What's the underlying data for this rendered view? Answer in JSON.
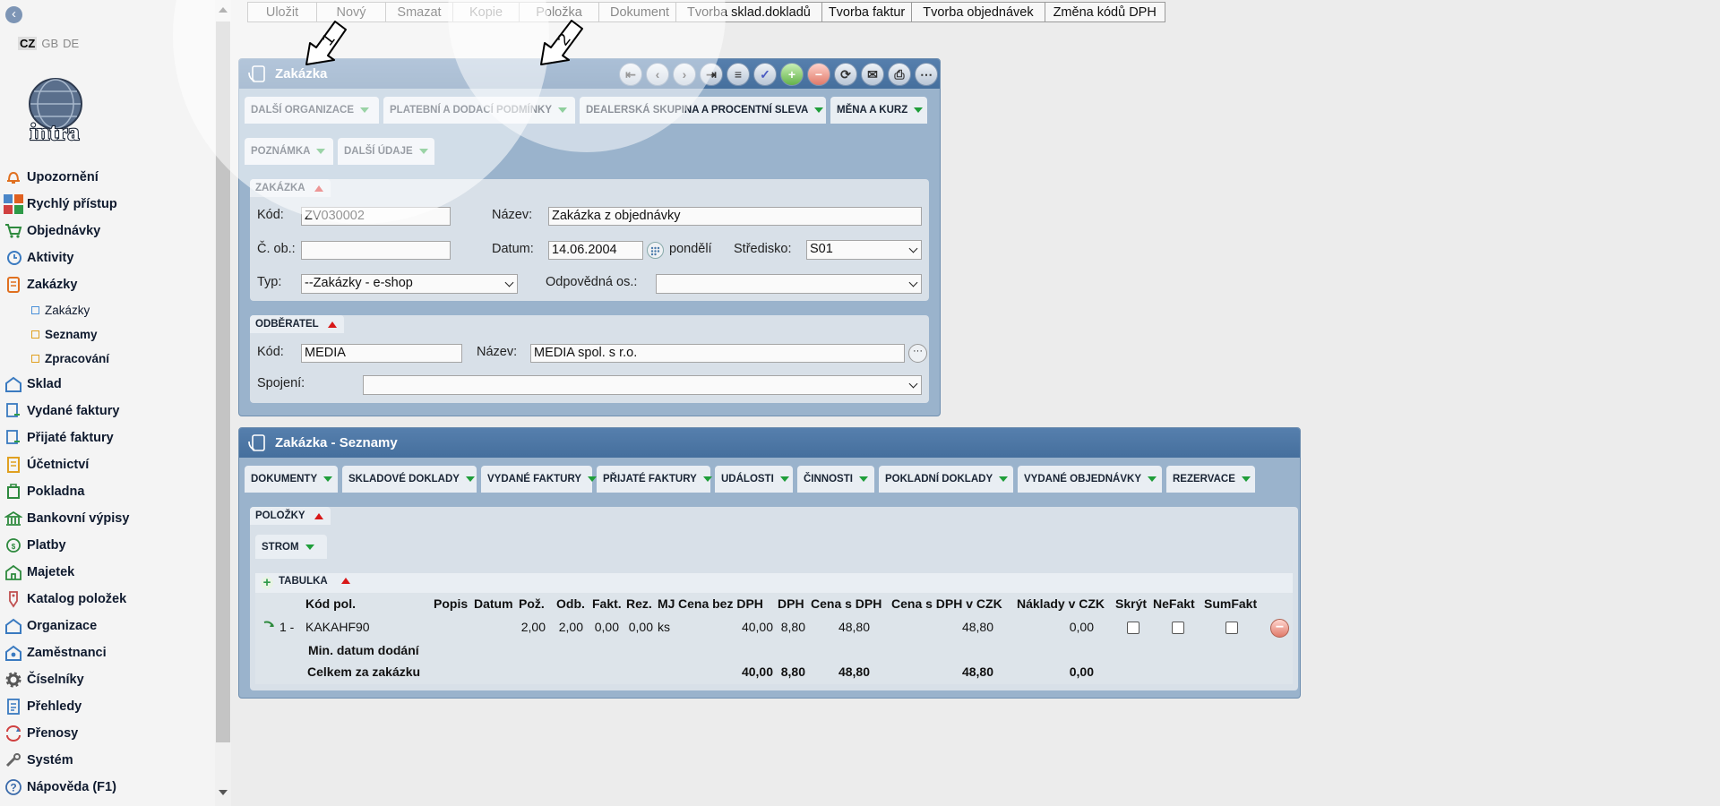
{
  "sidebar": {
    "languages": [
      "CZ",
      "GB",
      "DE"
    ],
    "active_language": "CZ",
    "logo_text": "intra",
    "items": [
      {
        "label": "Upozornění",
        "icon": "bell-icon"
      },
      {
        "label": "Rychlý přístup",
        "icon": "quick-access-icon"
      },
      {
        "label": "Objednávky",
        "icon": "cart-icon"
      },
      {
        "label": "Aktivity",
        "icon": "clock-icon"
      },
      {
        "label": "Zakázky",
        "icon": "order-icon"
      },
      {
        "label": "Zakázky",
        "icon": "square-icon",
        "sub": true
      },
      {
        "label": "Seznamy",
        "icon": "square-icon",
        "sub": true
      },
      {
        "label": "Zpracování",
        "icon": "square-icon",
        "sub": true
      },
      {
        "label": "Sklad",
        "icon": "warehouse-icon"
      },
      {
        "label": "Vydané faktury",
        "icon": "invoice-out-icon"
      },
      {
        "label": "Přijaté faktury",
        "icon": "invoice-in-icon"
      },
      {
        "label": "Účetnictví",
        "icon": "ledger-icon"
      },
      {
        "label": "Pokladna",
        "icon": "cash-register-icon"
      },
      {
        "label": "Bankovní výpisy",
        "icon": "bank-icon"
      },
      {
        "label": "Platby",
        "icon": "payment-icon"
      },
      {
        "label": "Majetek",
        "icon": "assets-icon"
      },
      {
        "label": "Katalog položek",
        "icon": "tag-icon"
      },
      {
        "label": "Organizace",
        "icon": "organization-icon"
      },
      {
        "label": "Zaměstnanci",
        "icon": "employee-icon"
      },
      {
        "label": "Číselníky",
        "icon": "gear-icon"
      },
      {
        "label": "Přehledy",
        "icon": "report-icon"
      },
      {
        "label": "Přenosy",
        "icon": "transfer-icon"
      },
      {
        "label": "Systém",
        "icon": "wrench-icon"
      },
      {
        "label": "Nápověda (F1)",
        "icon": "help-icon"
      }
    ]
  },
  "toolbar": [
    "Uložit",
    "Nový",
    "Smazat",
    "Kopie",
    "Položka",
    "Dokument",
    "Tvorba sklad.dokladů",
    "Tvorba faktur",
    "Tvorba objednávek",
    "Změna kódů DPH"
  ],
  "annotations": [
    "1",
    "2"
  ],
  "order_panel": {
    "title": "Zakázka",
    "tabs_row1": [
      "DALŠÍ ORGANIZACE",
      "PLATEBNÍ A DODACÍ PODMÍNKY",
      "DEALERSKÁ SKUPINA A PROCENTNÍ SLEVA",
      "MĚNA A KURZ"
    ],
    "tabs_row2": [
      "POZNÁMKA",
      "DALŠÍ ÚDAJE"
    ],
    "section_order": {
      "title": "ZAKÁZKA",
      "kod_label": "Kód:",
      "kod": "ZV030002",
      "nazev_label": "Název:",
      "nazev": "Zakázka z objednávky",
      "cob_label": "Č. ob.:",
      "cob": "",
      "datum_label": "Datum:",
      "datum": "14.06.2004",
      "den": "pondělí",
      "stredisko_label": "Středisko:",
      "stredisko": "S01",
      "typ_label": "Typ:",
      "typ": "--Zakázky - e-shop",
      "odp_label": "Odpovědná os.:",
      "odp": ""
    },
    "section_customer": {
      "title": "ODBĚRATEL",
      "kod_label": "Kód:",
      "kod": "MEDIA",
      "nazev_label": "Název:",
      "nazev": "MEDIA spol. s r.o.",
      "spojeni_label": "Spojení:",
      "spojeni": ""
    }
  },
  "lists_panel": {
    "title": "Zakázka - Seznamy",
    "tabs": [
      "DOKUMENTY",
      "SKLADOVÉ DOKLADY",
      "VYDANÉ FAKTURY",
      "PŘIJATÉ FAKTURY",
      "UDÁLOSTI",
      "ČINNOSTI",
      "POKLADNÍ DOKLADY",
      "VYDANÉ OBJEDNÁVKY",
      "REZERVACE"
    ],
    "section_title": "POLOŽKY",
    "strom_tab": "STROM",
    "table_title": "TABULKA",
    "columns": [
      "Kód pol.",
      "Popis",
      "Datum",
      "Pož.",
      "Odb.",
      "Fakt.",
      "Rez.",
      "MJ",
      "Cena bez DPH",
      "DPH",
      "Cena s DPH",
      "Cena s DPH v CZK",
      "Náklady v CZK",
      "Skrýt",
      "NeFakt",
      "SumFakt"
    ],
    "rows": [
      {
        "num": "1 -",
        "kod": "KAKAHF90",
        "poz": "2,00",
        "odb": "2,00",
        "fakt": "0,00",
        "rez": "0,00",
        "mj": "ks",
        "cena_bez": "40,00",
        "dph": "8,80",
        "cena_s": "48,80",
        "cena_czk": "48,80",
        "naklady": "0,00"
      }
    ],
    "min_date_label": "Min. datum dodání",
    "total": {
      "label": "Celkem za zakázku",
      "cena_bez": "40,00",
      "dph": "8,80",
      "cena_s": "48,80",
      "cena_czk": "48,80",
      "naklady": "0,00"
    }
  }
}
